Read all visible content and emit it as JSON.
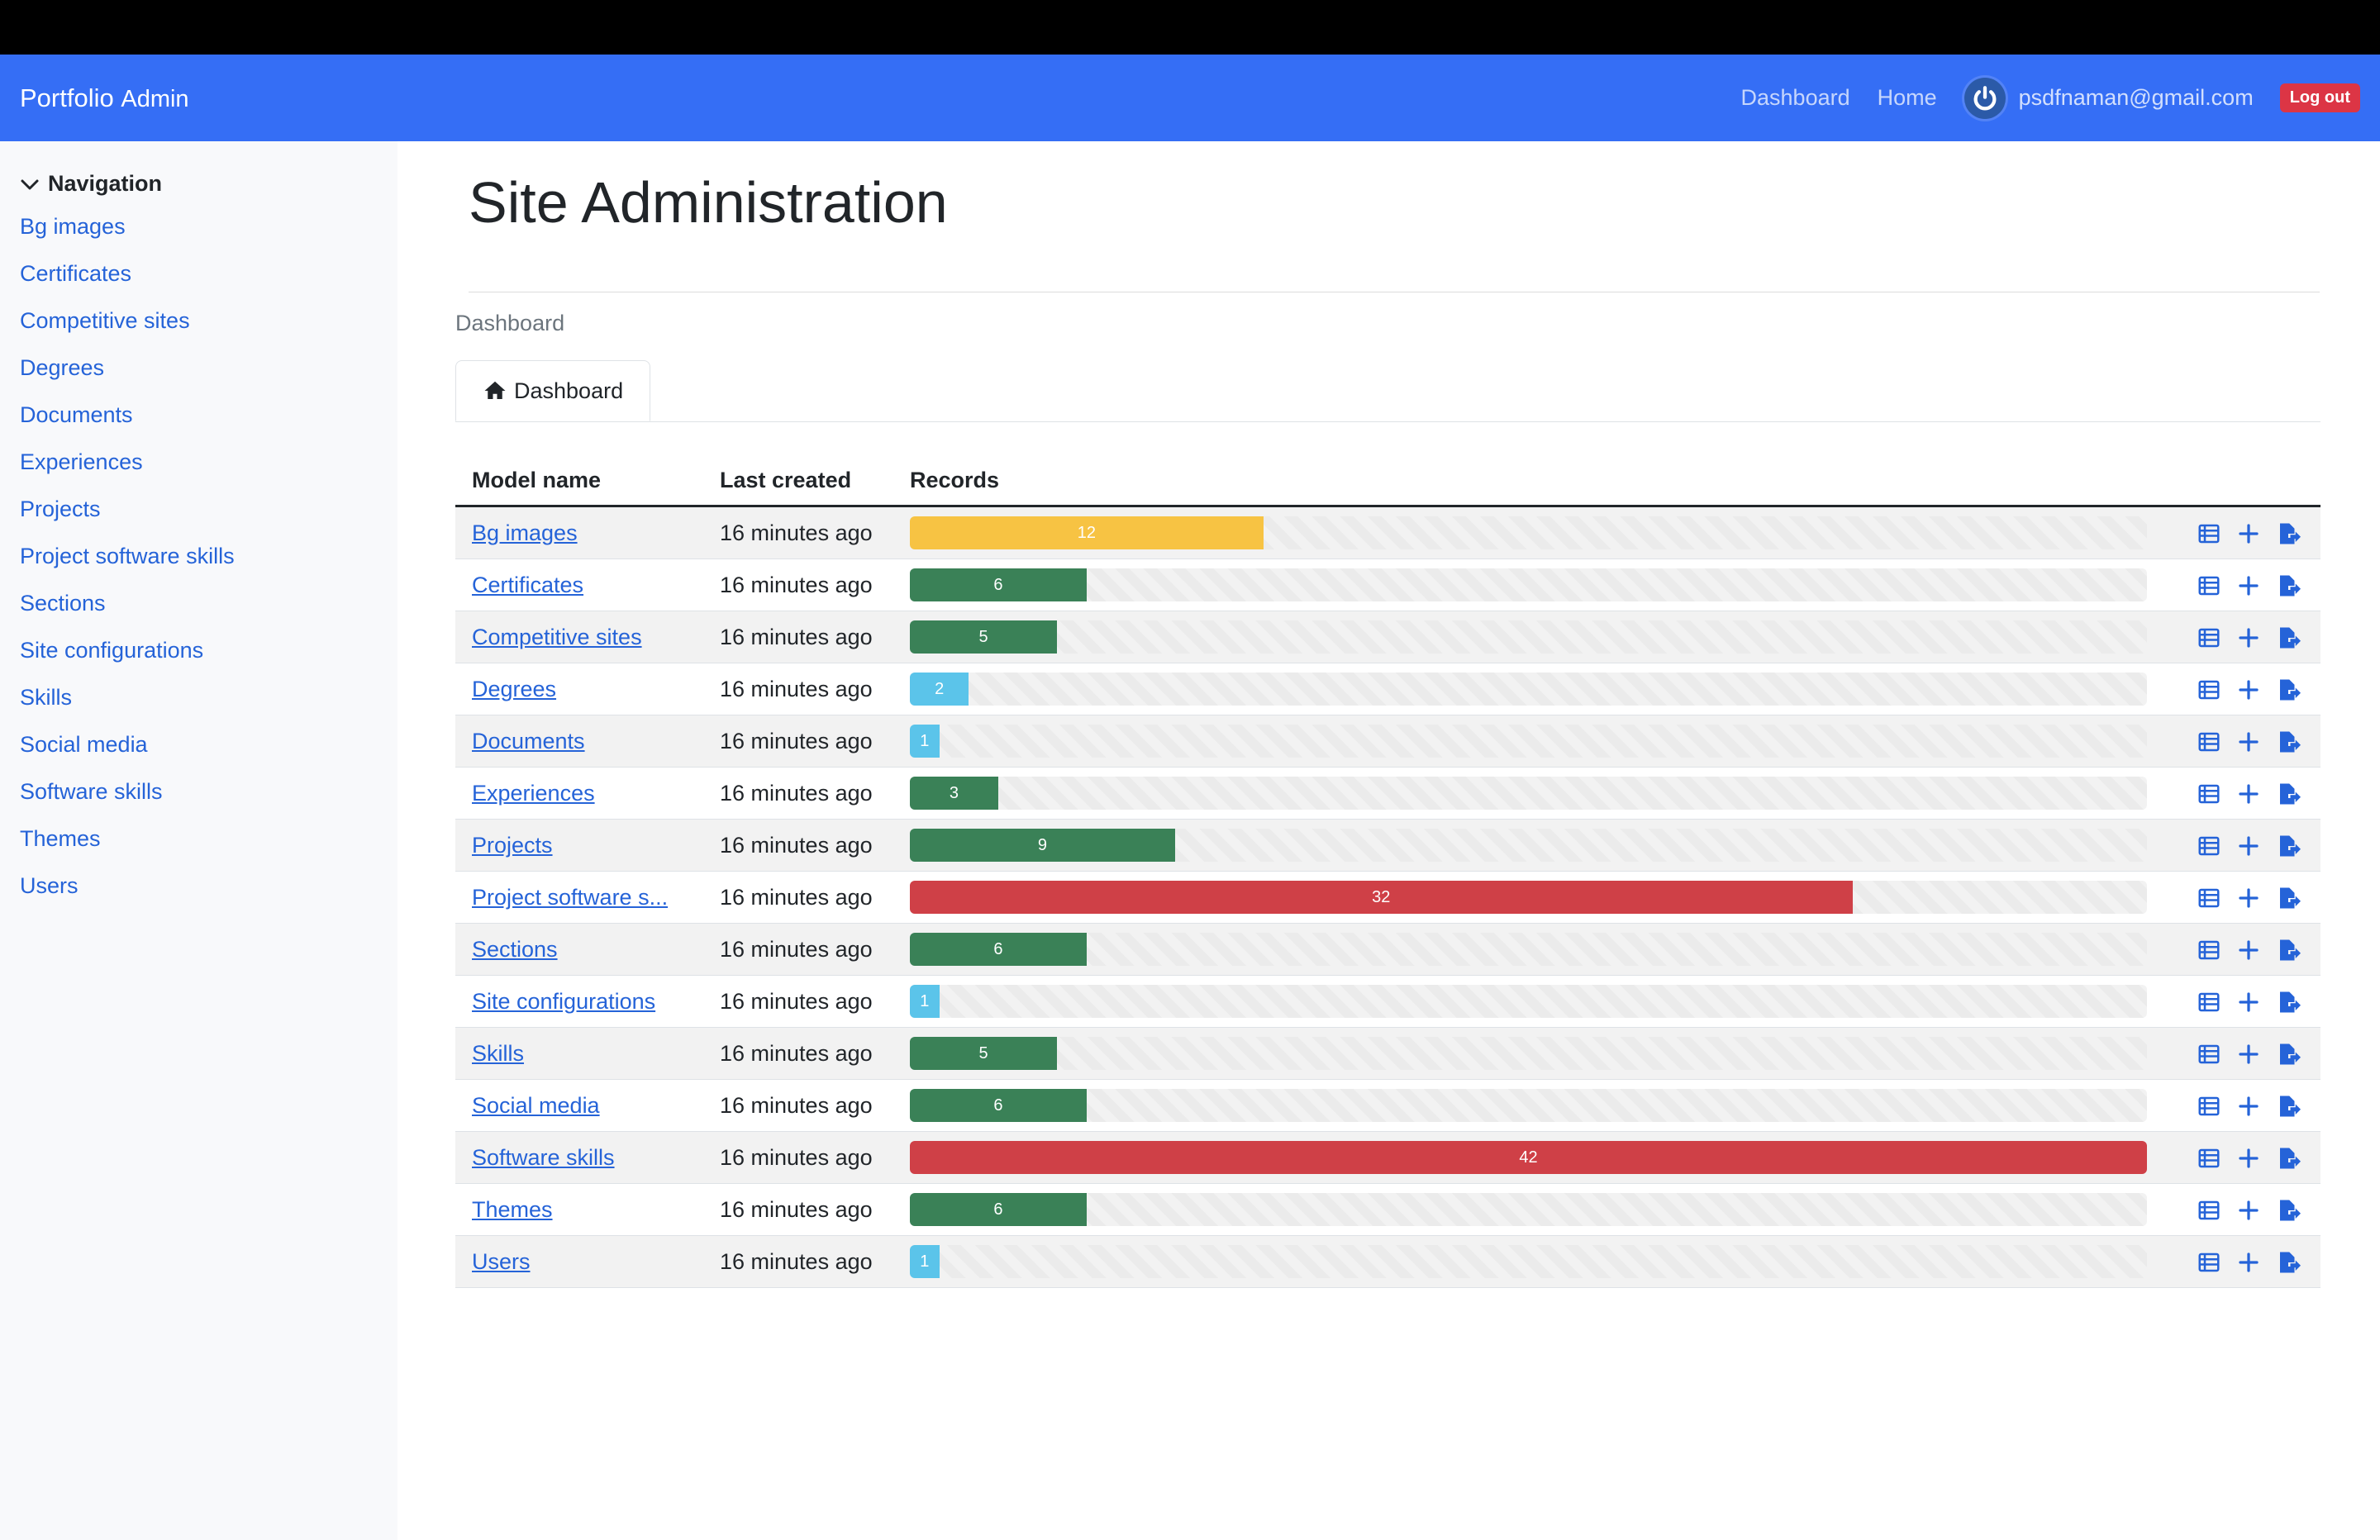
{
  "navbar": {
    "brand": "Portfolio",
    "brand_sub": "Admin",
    "links": [
      "Dashboard",
      "Home"
    ],
    "user_email": "psdfnaman@gmail.com",
    "logout_label": "Log out"
  },
  "sidebar": {
    "heading": "Navigation",
    "items": [
      "Bg images",
      "Certificates",
      "Competitive sites",
      "Degrees",
      "Documents",
      "Experiences",
      "Projects",
      "Project software skills",
      "Sections",
      "Site configurations",
      "Skills",
      "Social media",
      "Software skills",
      "Themes",
      "Users"
    ]
  },
  "main": {
    "title": "Site Administration",
    "breadcrumb": "Dashboard",
    "tab_label": "Dashboard",
    "columns": [
      "Model name",
      "Last created",
      "Records"
    ],
    "max_records": 42,
    "rows": [
      {
        "name": "Bg images",
        "created": "16 minutes ago",
        "records": 12,
        "color": "#f7c343"
      },
      {
        "name": "Certificates",
        "created": "16 minutes ago",
        "records": 6,
        "color": "#3a8157"
      },
      {
        "name": "Competitive sites",
        "created": "16 minutes ago",
        "records": 5,
        "color": "#3a8157"
      },
      {
        "name": "Degrees",
        "created": "16 minutes ago",
        "records": 2,
        "color": "#5bc4ea"
      },
      {
        "name": "Documents",
        "created": "16 minutes ago",
        "records": 1,
        "color": "#5bc4ea"
      },
      {
        "name": "Experiences",
        "created": "16 minutes ago",
        "records": 3,
        "color": "#3a8157"
      },
      {
        "name": "Projects",
        "created": "16 minutes ago",
        "records": 9,
        "color": "#3a8157"
      },
      {
        "name": "Project software s...",
        "created": "16 minutes ago",
        "records": 32,
        "color": "#cf4047"
      },
      {
        "name": "Sections",
        "created": "16 minutes ago",
        "records": 6,
        "color": "#3a8157"
      },
      {
        "name": "Site configurations",
        "created": "16 minutes ago",
        "records": 1,
        "color": "#5bc4ea"
      },
      {
        "name": "Skills",
        "created": "16 minutes ago",
        "records": 5,
        "color": "#3a8157"
      },
      {
        "name": "Social media",
        "created": "16 minutes ago",
        "records": 6,
        "color": "#3a8157"
      },
      {
        "name": "Software skills",
        "created": "16 minutes ago",
        "records": 42,
        "color": "#cf4047"
      },
      {
        "name": "Themes",
        "created": "16 minutes ago",
        "records": 6,
        "color": "#3a8157"
      },
      {
        "name": "Users",
        "created": "16 minutes ago",
        "records": 1,
        "color": "#5bc4ea"
      }
    ],
    "row_actions": [
      "list-icon",
      "plus-icon",
      "export-file-icon"
    ]
  },
  "colors": {
    "navbar": "#356ef5",
    "link": "#2563d8",
    "logout": "#dc3545"
  }
}
